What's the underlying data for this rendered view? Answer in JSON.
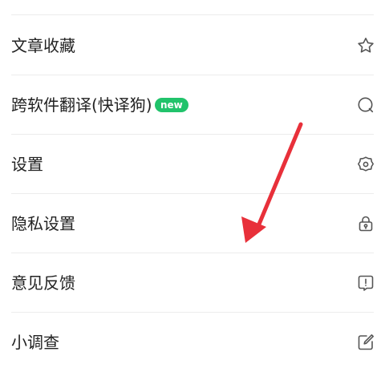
{
  "menu": {
    "items": [
      {
        "label": "文章收藏",
        "icon": "star-icon"
      },
      {
        "label": "跨软件翻译(快译狗)",
        "badge": "new",
        "icon": "search-icon"
      },
      {
        "label": "设置",
        "icon": "gear-icon"
      },
      {
        "label": "隐私设置",
        "icon": "lock-icon"
      },
      {
        "label": "意见反馈",
        "icon": "feedback-icon"
      },
      {
        "label": "小调查",
        "icon": "edit-icon"
      }
    ]
  },
  "colors": {
    "badge": "#21c36b",
    "arrow": "#e8303a",
    "text": "#222222",
    "icon": "#555555",
    "divider": "#ececec"
  },
  "annotation": {
    "icon": "arrow-icon"
  }
}
